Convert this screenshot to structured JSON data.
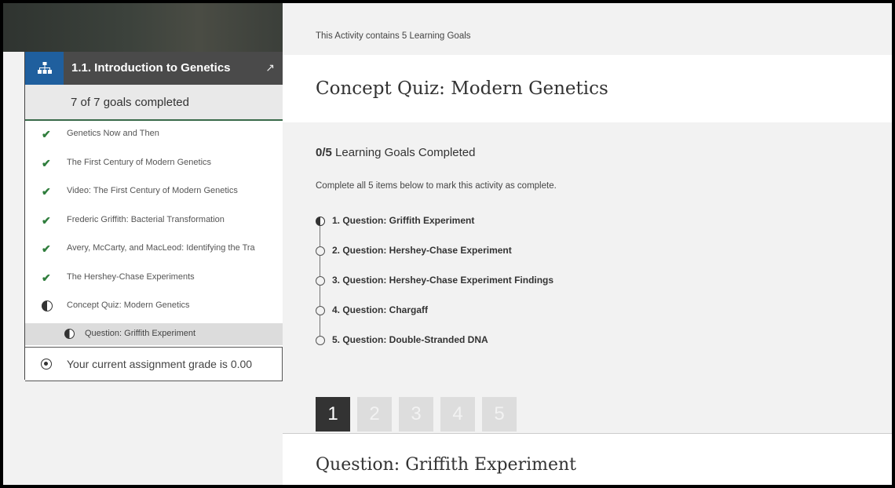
{
  "sidebar": {
    "course_title": "1.1. Introduction to Genetics",
    "goals_summary": "7 of 7 goals completed",
    "items": [
      {
        "label": "Genetics Now and Then",
        "status": "complete"
      },
      {
        "label": "The First Century of Modern Genetics",
        "status": "complete"
      },
      {
        "label": "Video: The First Century of Modern Genetics",
        "status": "complete"
      },
      {
        "label": "Frederic Griffith: Bacterial Transformation",
        "status": "complete"
      },
      {
        "label": "Avery, McCarty, and MacLeod: Identifying the Tra",
        "status": "complete"
      },
      {
        "label": "The Hershey-Chase Experiments",
        "status": "complete"
      },
      {
        "label": "Concept Quiz: Modern Genetics",
        "status": "in-progress"
      }
    ],
    "sub_item": {
      "label": "Question: Griffith Experiment",
      "status": "in-progress"
    },
    "grade_text": "Your current assignment grade is 0.00"
  },
  "main": {
    "activity_info": "This Activity contains 5 Learning Goals",
    "activity_title": "Concept Quiz: Modern Genetics",
    "progress_count": "0/5",
    "progress_label": "Learning Goals Completed",
    "instruction": "Complete all 5 items below to mark this activity as complete.",
    "questions": [
      {
        "label": "1. Question: Griffith Experiment",
        "status": "in-progress"
      },
      {
        "label": "2. Question: Hershey-Chase Experiment",
        "status": "not-started"
      },
      {
        "label": "3. Question: Hershey-Chase Experiment Findings",
        "status": "not-started"
      },
      {
        "label": "4. Question: Chargaff",
        "status": "not-started"
      },
      {
        "label": "5. Question: Double-Stranded DNA",
        "status": "not-started"
      }
    ],
    "pages": [
      "1",
      "2",
      "3",
      "4",
      "5"
    ],
    "current_page": "1",
    "question_title": "Question: Griffith Experiment"
  },
  "icons": {
    "course": "hierarchy-icon",
    "collapse": "collapse-arrows-icon",
    "complete": "checkmark-icon",
    "in_progress": "half-circle-icon",
    "not_started": "empty-circle-icon",
    "grade": "target-circle-icon"
  },
  "colors": {
    "accent_blue": "#1f5f9e",
    "check_green": "#2f7d3c",
    "header_dark": "#4a4a4a"
  }
}
